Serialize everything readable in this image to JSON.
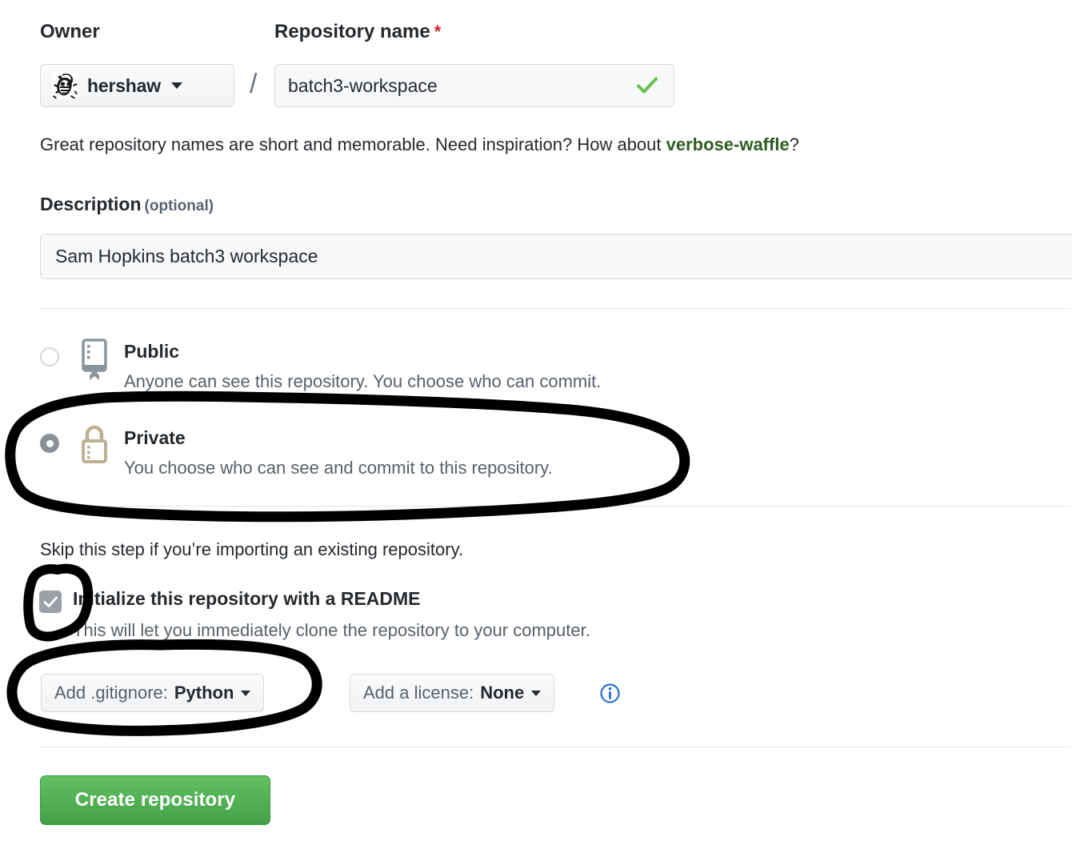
{
  "form": {
    "owner": {
      "label": "Owner",
      "name": "hershaw",
      "avatar_icon": "user-avatar-cartoon-face"
    },
    "repository_name": {
      "label": "Repository name",
      "required_marker": "*",
      "value": "batch3-workspace",
      "valid_icon": "green-checkmark-icon"
    },
    "helper": {
      "prefix": "Great repository names are short and memorable. Need inspiration? How about ",
      "suggestion": "verbose-waffle",
      "suffix": "?"
    },
    "description": {
      "label": "Description",
      "optional_note": "(optional)",
      "value": "Sam Hopkins batch3 workspace"
    },
    "visibility": {
      "public": {
        "title": "Public",
        "subtitle": "Anyone can see this repository. You choose who can commit.",
        "selected": false,
        "icon": "repo-book-icon"
      },
      "private": {
        "title": "Private",
        "subtitle": "You choose who can see and commit to this repository.",
        "selected": true,
        "icon": "lock-icon"
      }
    },
    "initialize": {
      "skip_note": "Skip this step if you’re importing an existing repository.",
      "readme_label": "Initialize this repository with a README",
      "readme_subtitle": "This will let you immediately clone the repository to your computer.",
      "readme_checked": true
    },
    "gitignore": {
      "prefix": "Add .gitignore:",
      "value": "Python"
    },
    "license": {
      "prefix": "Add a license:",
      "value": "None",
      "info_icon": "info-circle-icon"
    },
    "submit": {
      "label": "Create repository"
    }
  },
  "annotations": [
    {
      "name": "private-option-highlight",
      "shape": "hand-drawn-ellipse",
      "target": "Private visibility option",
      "color": "#000000"
    },
    {
      "name": "readme-checkbox-highlight",
      "shape": "hand-drawn-rounded-square",
      "target": "Initialize with README checkbox",
      "color": "#000000"
    },
    {
      "name": "gitignore-dropdown-highlight",
      "shape": "hand-drawn-ellipse",
      "target": "Add .gitignore dropdown",
      "color": "#000000"
    }
  ],
  "colors": {
    "accent_green": "#43a047",
    "suggestion_green": "#2f5d21",
    "required_red": "#cb2431",
    "info_blue": "#2a6ed4",
    "lock_tan": "#bdb193",
    "repo_icon_gray": "#8b949e",
    "annotation_black": "#000000"
  }
}
